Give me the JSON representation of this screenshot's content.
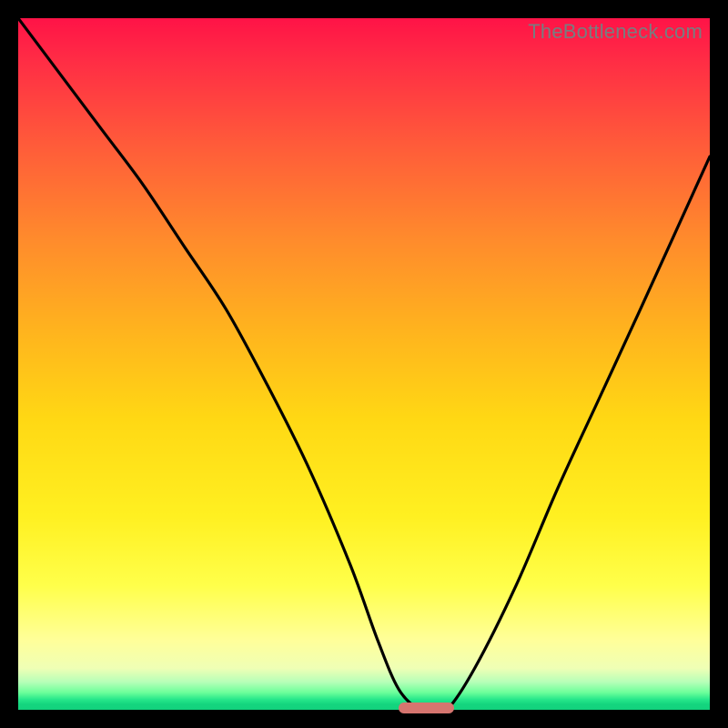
{
  "watermark": "TheBottleneck.com",
  "colors": {
    "frame": "#000000",
    "marker": "#d6756f",
    "curve": "#000000"
  },
  "chart_data": {
    "type": "line",
    "title": "",
    "xlabel": "",
    "ylabel": "",
    "xlim": [
      0,
      100
    ],
    "ylim": [
      0,
      100
    ],
    "grid": false,
    "legend": false,
    "series": [
      {
        "name": "bottleneck-curve",
        "x": [
          0,
          6,
          12,
          18,
          24,
          30,
          36,
          42,
          48,
          52,
          55,
          58,
          60,
          62,
          66,
          72,
          78,
          84,
          90,
          100
        ],
        "values": [
          100,
          92,
          84,
          76,
          67,
          58,
          47,
          35,
          21,
          10,
          3,
          0,
          0,
          0,
          6,
          18,
          32,
          45,
          58,
          80
        ]
      }
    ],
    "marker": {
      "x_start": 55,
      "x_end": 63,
      "y": 0
    },
    "gradient_stops": [
      {
        "pos": 0,
        "color": "#ff1347"
      },
      {
        "pos": 0.32,
        "color": "#ff8b2c"
      },
      {
        "pos": 0.58,
        "color": "#ffd814"
      },
      {
        "pos": 0.82,
        "color": "#ffff4a"
      },
      {
        "pos": 0.96,
        "color": "#b6ffb8"
      },
      {
        "pos": 1.0,
        "color": "#13d27d"
      }
    ]
  }
}
